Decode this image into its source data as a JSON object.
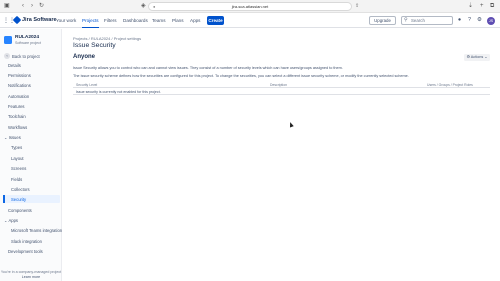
{
  "browser": {
    "url": "jira-sca.atlassian.net",
    "back_icon": "back-arrow-icon",
    "forward_icon": "forward-arrow-icon",
    "reload_icon": "reload-icon",
    "sidebar_toggle_icon": "sidebar-toggle-icon"
  },
  "topnav": {
    "app_name": "Jira Software",
    "items": [
      "Your work",
      "Projects",
      "Filters",
      "Dashboards",
      "Teams",
      "Plans",
      "Apps"
    ],
    "active_item": "Projects",
    "create_label": "Create",
    "upgrade_label": "Upgrade",
    "search_placeholder": "Search",
    "avatar_initials": "JS"
  },
  "sidebar": {
    "project_name": "RULA2024",
    "project_type": "Software project",
    "back_label": "Back to project",
    "items": [
      {
        "label": "Details",
        "kind": "item"
      },
      {
        "label": "Permissions",
        "kind": "item"
      },
      {
        "label": "Notifications",
        "kind": "item"
      },
      {
        "label": "Automation",
        "kind": "item"
      },
      {
        "label": "Features",
        "kind": "item"
      },
      {
        "label": "Toolchain",
        "kind": "item"
      },
      {
        "label": "Workflows",
        "kind": "item"
      },
      {
        "label": "Issues",
        "kind": "group"
      },
      {
        "label": "Types",
        "kind": "sub"
      },
      {
        "label": "Layout",
        "kind": "sub"
      },
      {
        "label": "Screens",
        "kind": "sub"
      },
      {
        "label": "Fields",
        "kind": "sub"
      },
      {
        "label": "Collectors",
        "kind": "sub"
      },
      {
        "label": "Security",
        "kind": "sub",
        "active": true
      },
      {
        "label": "Components",
        "kind": "item"
      },
      {
        "label": "Apps",
        "kind": "group"
      },
      {
        "label": "Microsoft Teams integration",
        "kind": "sub"
      },
      {
        "label": "Slack integration",
        "kind": "sub"
      },
      {
        "label": "Development tools",
        "kind": "item"
      }
    ],
    "footer_text": "You're in a company-managed project",
    "footer_link": "Learn more"
  },
  "main": {
    "breadcrumbs": [
      "Projects",
      "RULA2024",
      "Project settings"
    ],
    "title": "Issue Security",
    "scheme_name": "Anyone",
    "actions_label": "Actions",
    "description_1": "Issue Security allows you to control who can and cannot view issues. They consist of a number of security levels which can have users/groups assigned to them.",
    "description_2": "The issue security scheme defines how the securities are configured for this project. To change the securities, you can select a different issue security scheme, or modify the currently selected scheme.",
    "table": {
      "headers": [
        "Security Level",
        "Description",
        "Users / Groups / Project Roles"
      ],
      "empty_message": "Issue security is currently not enabled for this project."
    }
  }
}
